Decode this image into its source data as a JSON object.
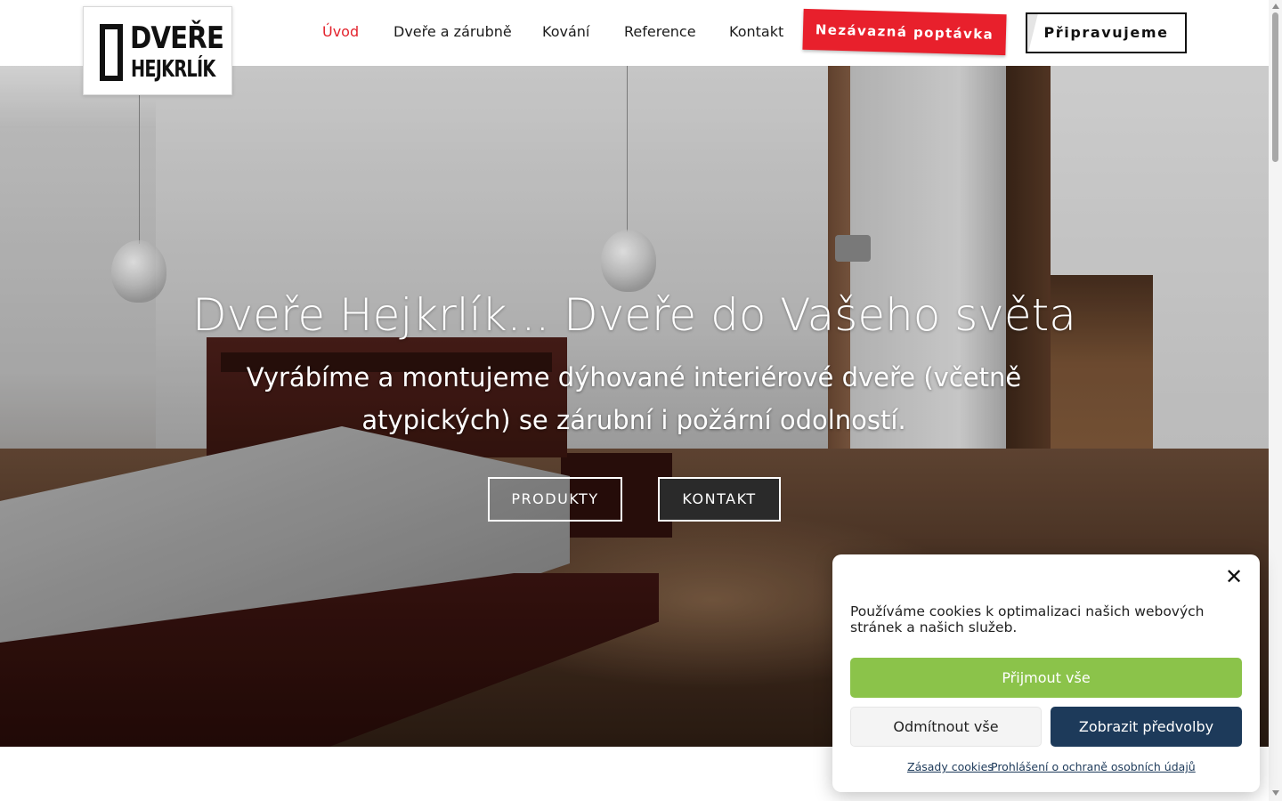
{
  "brand": {
    "logo_line1": "DVEŘE",
    "logo_line2": "HEJKRLÍK"
  },
  "nav": {
    "items": [
      {
        "label": "Úvod",
        "active": true
      },
      {
        "label": "Dveře a zárubně",
        "active": false
      },
      {
        "label": "Kování",
        "active": false
      },
      {
        "label": "Reference",
        "active": false
      },
      {
        "label": "Kontakt",
        "active": false
      }
    ],
    "quote_button": "Nezávazná poptávka",
    "prepare_button": "Připravujeme"
  },
  "hero": {
    "title": "Dveře Hejkrlík... Dveře do Vašeho světa",
    "subtitle": "Vyrábíme a montujeme dýhované interiérové dveře (včetně atypických) se zárubní i požární odolností.",
    "products_button": "PRODUKTY",
    "contact_button": "KONTAKT"
  },
  "cookie": {
    "text": "Používáme cookies k optimalizaci našich webových stránek a našich služeb.",
    "accept": "Přijmout vše",
    "deny": "Odmítnout vše",
    "preferences": "Zobrazit předvolby",
    "link_cookies": "Zásady cookies",
    "link_privacy": "Prohlášení o ochraně osobních údajů",
    "close_icon": "close-icon"
  },
  "colors": {
    "accent_red": "#e8202c",
    "active_nav": "#e3232d",
    "accept_green": "#8bc34a",
    "prefs_navy": "#1d3a5a"
  }
}
